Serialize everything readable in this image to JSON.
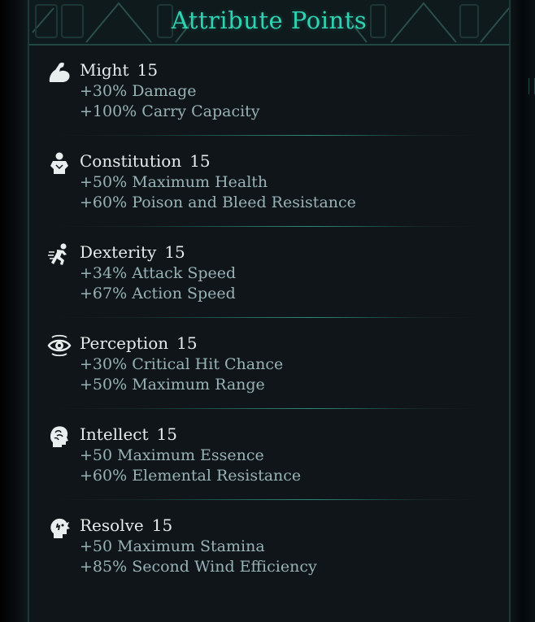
{
  "title": "Attribute Points",
  "attributes": [
    {
      "name": "Might",
      "value": "15",
      "bonus1": "+30% Damage",
      "bonus2": "+100% Carry Capacity",
      "icon": "flexed-arm-icon"
    },
    {
      "name": "Constitution",
      "value": "15",
      "bonus1": "+50% Maximum Health",
      "bonus2": "+60% Poison and Bleed Resistance",
      "icon": "torso-icon"
    },
    {
      "name": "Dexterity",
      "value": "15",
      "bonus1": "+34% Attack Speed",
      "bonus2": "+67% Action Speed",
      "icon": "running-figure-icon"
    },
    {
      "name": "Perception",
      "value": "15",
      "bonus1": "+30% Critical Hit Chance",
      "bonus2": "+50% Maximum Range",
      "icon": "eye-icon"
    },
    {
      "name": "Intellect",
      "value": "15",
      "bonus1": "+50 Maximum Essence",
      "bonus2": "+60% Elemental Resistance",
      "icon": "brain-head-icon"
    },
    {
      "name": "Resolve",
      "value": "15",
      "bonus1": "+50 Maximum Stamina",
      "bonus2": "+85% Second Wind Efficiency",
      "icon": "resolve-head-icon"
    }
  ],
  "colors": {
    "accent": "#2fd3b4",
    "text": "#e6ecec",
    "bonus": "#98b3b7",
    "panel": "#0f1518"
  }
}
